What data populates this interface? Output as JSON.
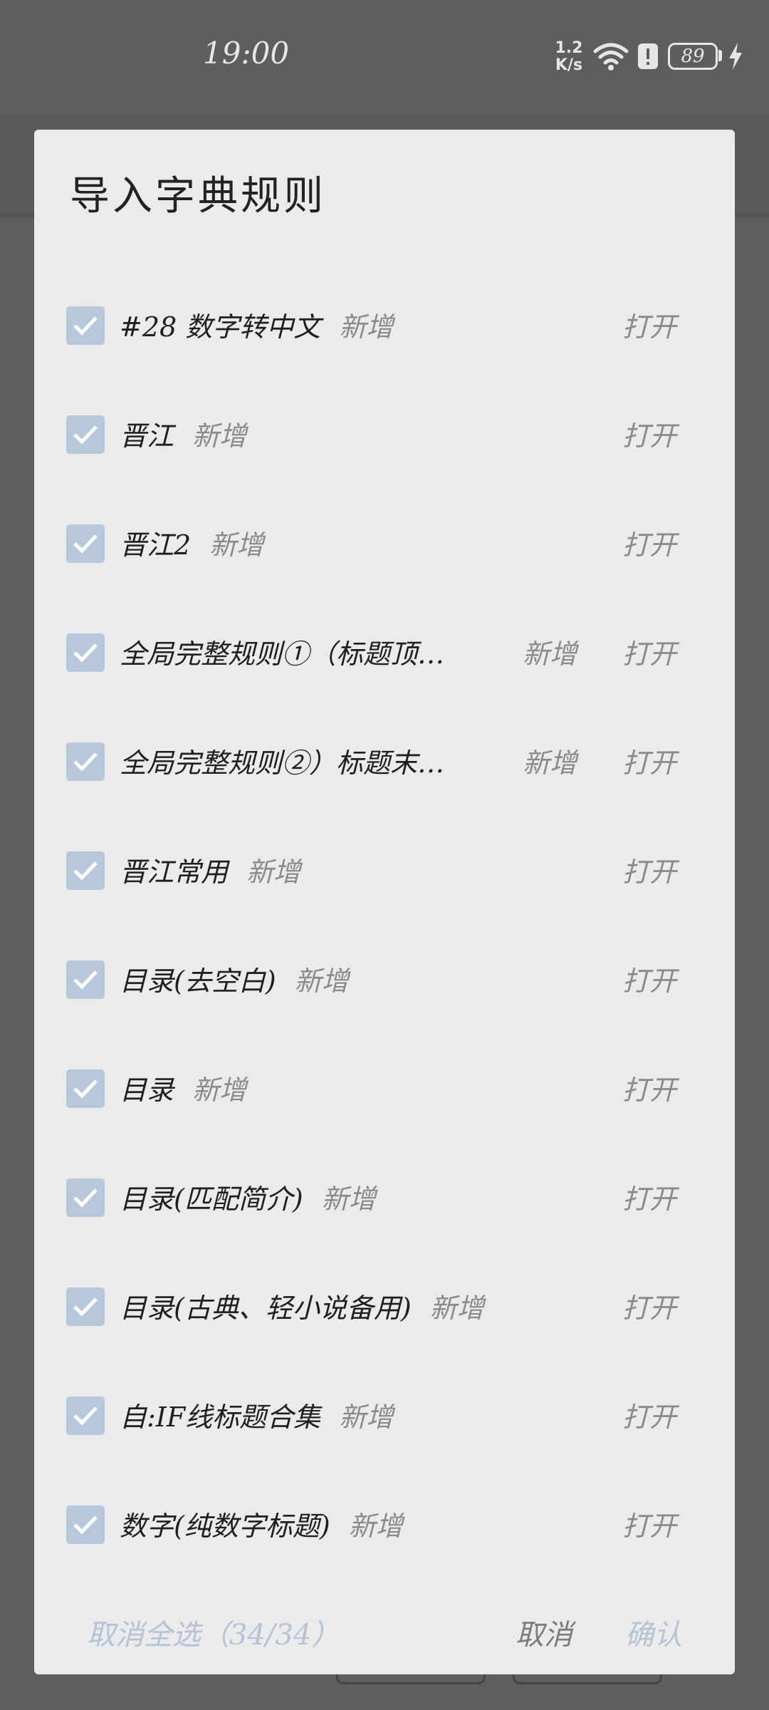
{
  "status_bar": {
    "time": "19:00",
    "net_speed_value": "1.2",
    "net_speed_unit": "K/s",
    "battery": "89",
    "icons": [
      "wifi-icon",
      "alert-icon",
      "battery-icon",
      "charging-bolt-icon"
    ]
  },
  "dialog": {
    "title": "导入字典规则",
    "rules": [
      {
        "name": "#28 数字转中文",
        "status": "新增",
        "action": "打开",
        "checked": true
      },
      {
        "name": "晋江",
        "status": "新增",
        "action": "打开",
        "checked": true
      },
      {
        "name": "晋江2",
        "status": "新增",
        "action": "打开",
        "checked": true
      },
      {
        "name": "全局完整规则①（标题顶…",
        "status": "新增",
        "action": "打开",
        "checked": true
      },
      {
        "name": "全局完整规则②）标题末…",
        "status": "新增",
        "action": "打开",
        "checked": true
      },
      {
        "name": "晋江常用",
        "status": "新增",
        "action": "打开",
        "checked": true
      },
      {
        "name": "目录(去空白)",
        "status": "新增",
        "action": "打开",
        "checked": true
      },
      {
        "name": "目录",
        "status": "新增",
        "action": "打开",
        "checked": true
      },
      {
        "name": "目录(匹配简介)",
        "status": "新增",
        "action": "打开",
        "checked": true
      },
      {
        "name": "目录(古典、轻小说备用)",
        "status": "新增",
        "action": "打开",
        "checked": true
      },
      {
        "name": "自:IF线标题合集",
        "status": "新增",
        "action": "打开",
        "checked": true
      },
      {
        "name": "数字(纯数字标题)",
        "status": "新增",
        "action": "打开",
        "checked": true
      }
    ],
    "deselect_all_label": "取消全选（34/34）",
    "cancel_label": "取消",
    "confirm_label": "确认"
  },
  "colors": {
    "overlay": "#5e5e5e",
    "dialog_bg": "#ebebeb",
    "checkbox": "#b7c8dc",
    "accent_disabled": "#b5c3d6",
    "secondary_text": "#8a8a8a"
  }
}
